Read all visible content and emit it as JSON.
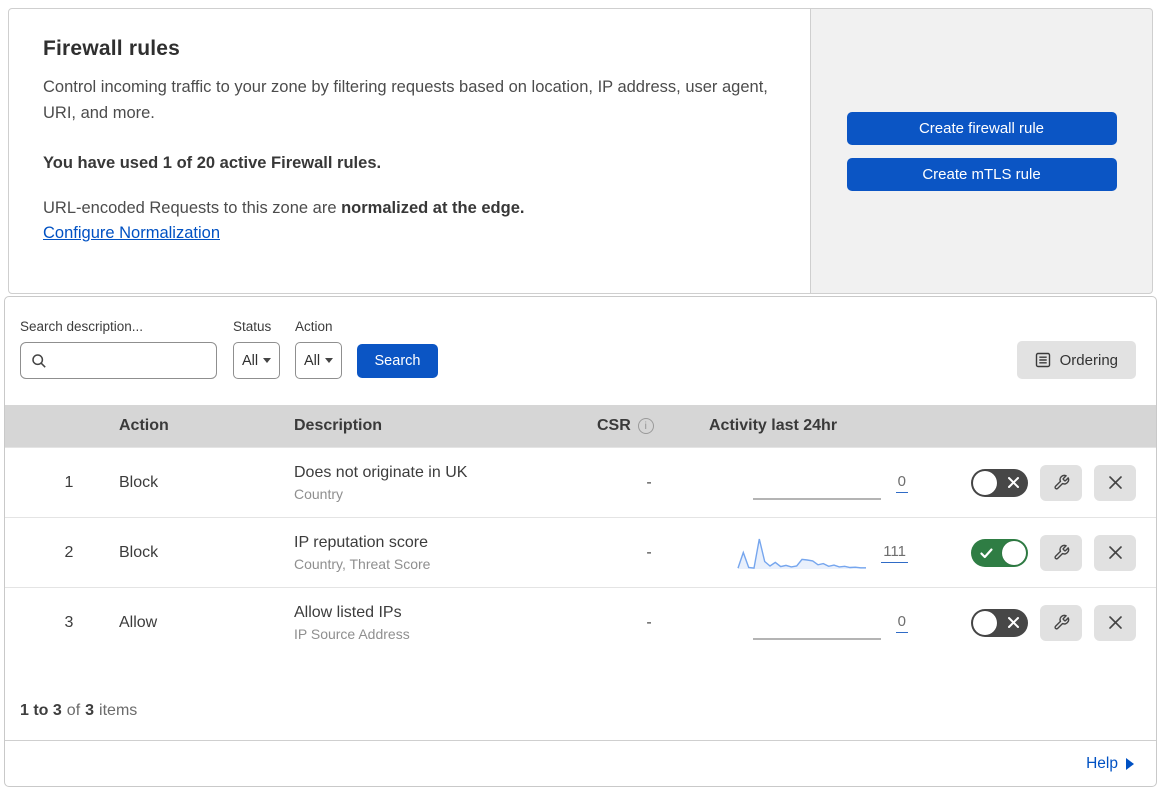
{
  "colors": {
    "accent_blue": "#0b55c4",
    "link_blue": "#0051c3",
    "toggle_on_green": "#2f7d44",
    "toggle_off_gray": "#474747",
    "sparkline_line": "#76a6ee",
    "sparkline_fill": "#e9f0fc",
    "sparkline_flat": "#9b9b9b",
    "header_gray": "#d6d6d6",
    "panel_gray": "#f1f1f1"
  },
  "header": {
    "title": "Firewall rules",
    "description": "Control incoming traffic to your zone by filtering requests based on location, IP address, user agent, URI, and more.",
    "usage": "You have used 1 of 20 active Firewall rules.",
    "normalization_prefix": "URL-encoded Requests to this zone are ",
    "normalization_bold": "normalized at the edge.",
    "normalization_link": "Configure Normalization",
    "create_firewall_button": "Create firewall rule",
    "create_mtls_button": "Create mTLS rule"
  },
  "filters": {
    "search_label": "Search description...",
    "status_label": "Status",
    "status_value": "All",
    "action_label": "Action",
    "action_value": "All",
    "search_button": "Search",
    "ordering_button": "Ordering"
  },
  "table": {
    "columns": {
      "action": "Action",
      "description": "Description",
      "csr": "CSR",
      "activity": "Activity last 24hr"
    },
    "rows": [
      {
        "index": "1",
        "action": "Block",
        "description": "Does not originate in UK",
        "fields": "Country",
        "csr": "-",
        "count": "0",
        "enabled": false,
        "sparkline": [
          0,
          0,
          0,
          0,
          0,
          0,
          0,
          0,
          0,
          0,
          0,
          0,
          0,
          0,
          0,
          0,
          0,
          0,
          0,
          0,
          0,
          0,
          0,
          0,
          0
        ]
      },
      {
        "index": "2",
        "action": "Block",
        "description": "IP reputation score",
        "fields": "Country, Threat Score",
        "csr": "-",
        "count": "111",
        "enabled": true,
        "sparkline": [
          3,
          55,
          5,
          3,
          100,
          25,
          10,
          22,
          8,
          12,
          7,
          10,
          32,
          30,
          27,
          14,
          18,
          9,
          13,
          7,
          9,
          5,
          6,
          4,
          4
        ]
      },
      {
        "index": "3",
        "action": "Allow",
        "description": "Allow listed IPs",
        "fields": "IP Source Address",
        "csr": "-",
        "count": "0",
        "enabled": false,
        "sparkline": [
          0,
          0,
          0,
          0,
          0,
          0,
          0,
          0,
          0,
          0,
          0,
          0,
          0,
          0,
          0,
          0,
          0,
          0,
          0,
          0,
          0,
          0,
          0,
          0,
          0
        ]
      }
    ],
    "summary": {
      "range": "1 to 3",
      "of": "of",
      "total": "3",
      "items": "items"
    }
  },
  "help": {
    "label": "Help"
  }
}
